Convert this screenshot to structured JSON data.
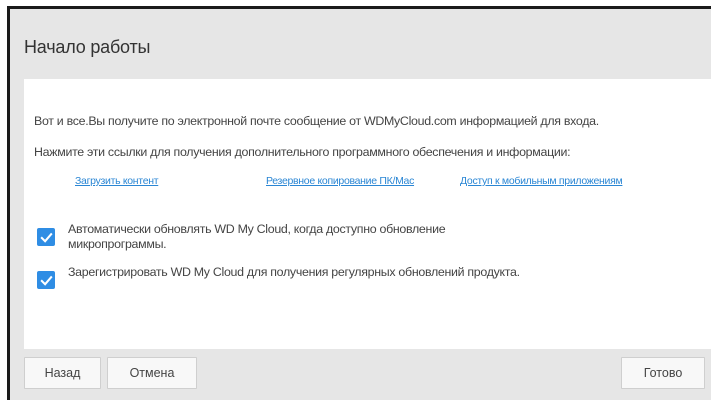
{
  "dialog": {
    "title": "Начало работы"
  },
  "content": {
    "message": "Вот и все.Вы получите по электронной почте сообщение от WDMyCloud.com информацией для входа.",
    "links_intro": "Нажмите эти ссылки для получения дополнительного программного обеспечения и информации:",
    "links": [
      {
        "label": "Загрузить контент"
      },
      {
        "label": "Резервное копирование ПК/Mac"
      },
      {
        "label": "Доступ к мобильным приложениям"
      }
    ],
    "options": [
      {
        "label": "Автоматически обновлять WD My Cloud, когда доступно обновление микропрограммы.",
        "checked": true
      },
      {
        "label": "Зарегистрировать WD My Cloud для получения регулярных обновлений продукта.",
        "checked": true
      }
    ]
  },
  "footer": {
    "back_label": "Назад",
    "cancel_label": "Отмена",
    "done_label": "Готово"
  },
  "colors": {
    "accent": "#2f8de4",
    "link": "#2a86d4",
    "dialog_background": "#e6e6e6",
    "content_background": "#ffffff"
  },
  "icons": {
    "checkbox": "checkmark-icon"
  }
}
